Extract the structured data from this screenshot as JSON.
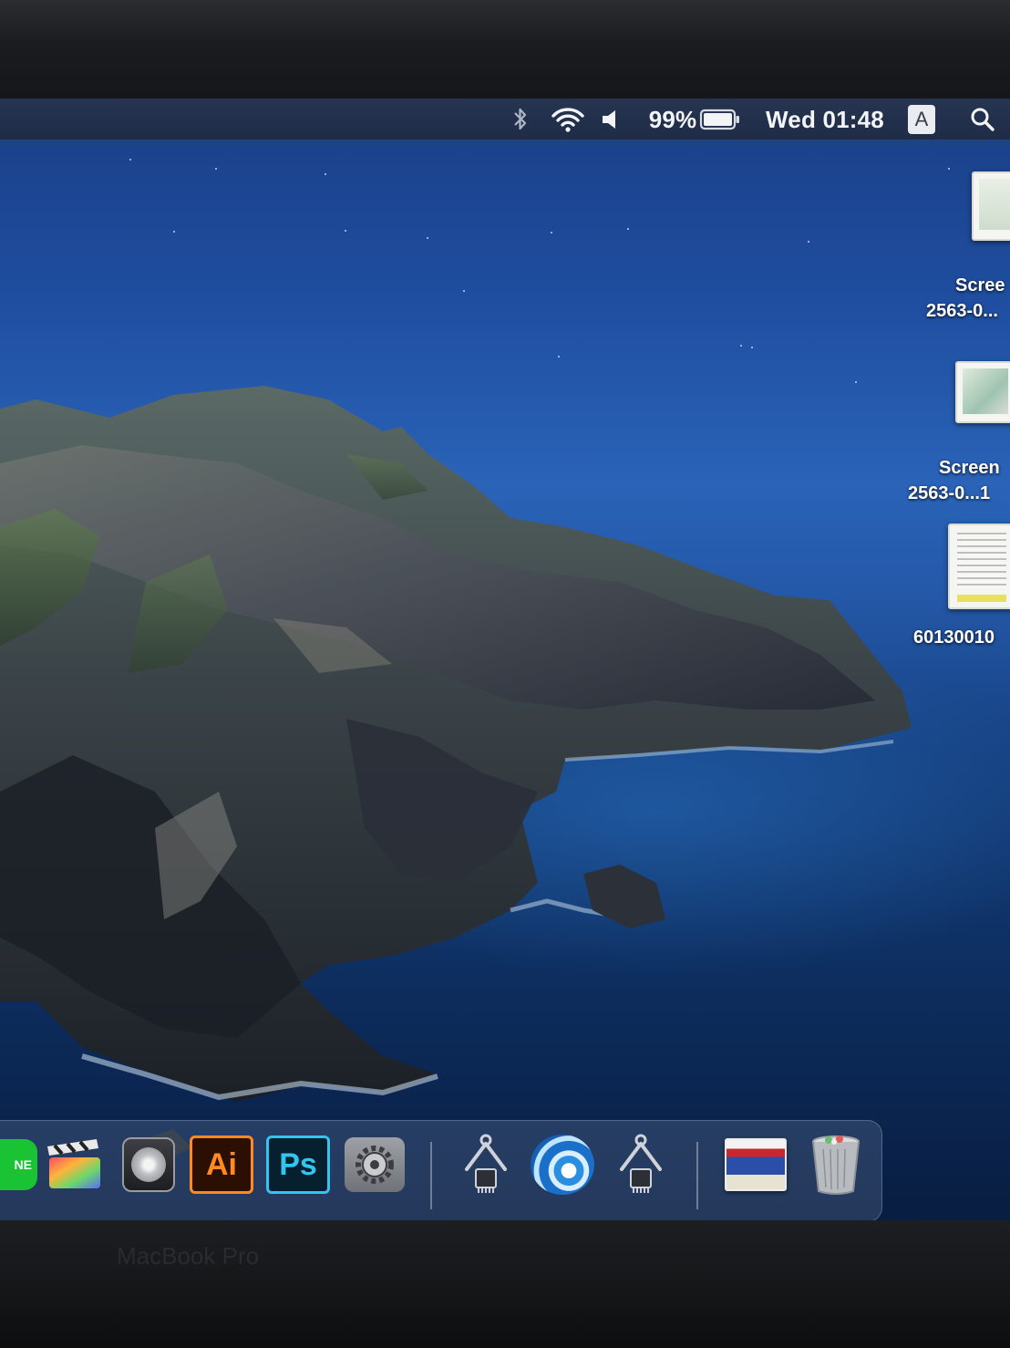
{
  "menubar": {
    "bluetooth_icon": "bluetooth-icon",
    "wifi_icon": "wifi-icon",
    "volume_icon": "volume-icon",
    "battery_percent": "99%",
    "battery_icon": "battery-icon",
    "datetime": "Wed 01:48",
    "input_source": "A",
    "spotlight_icon": "search-icon"
  },
  "desktop": {
    "files": [
      {
        "label_line1": "Scree",
        "label_line2": "2563-0..."
      },
      {
        "label_line1": "Screen",
        "label_line2": "2563-0...1"
      },
      {
        "label_line1": "60130010",
        "label_line2": ""
      }
    ]
  },
  "dock": {
    "apps": [
      {
        "name": "LINE",
        "label": "NE"
      },
      {
        "name": "Final Cut Pro",
        "label": ""
      },
      {
        "name": "Compressor",
        "label": ""
      },
      {
        "name": "Adobe Illustrator",
        "label": "Ai"
      },
      {
        "name": "Adobe Photoshop",
        "label": "Ps"
      },
      {
        "name": "System Preferences",
        "label": ""
      },
      {
        "name": "Driver Utility",
        "label": ""
      },
      {
        "name": "Wave App",
        "label": ""
      },
      {
        "name": "Driver Utility 2",
        "label": ""
      },
      {
        "name": "Downloads Stack",
        "label": ""
      },
      {
        "name": "Trash",
        "label": ""
      }
    ]
  },
  "device": {
    "brand": "MacBook Pro"
  },
  "colors": {
    "illustrator_bg": "#2b0f02",
    "illustrator_fg": "#ff8a1f",
    "photoshop_bg": "#062030",
    "photoshop_fg": "#31c5f0",
    "line_green": "#19c334"
  }
}
